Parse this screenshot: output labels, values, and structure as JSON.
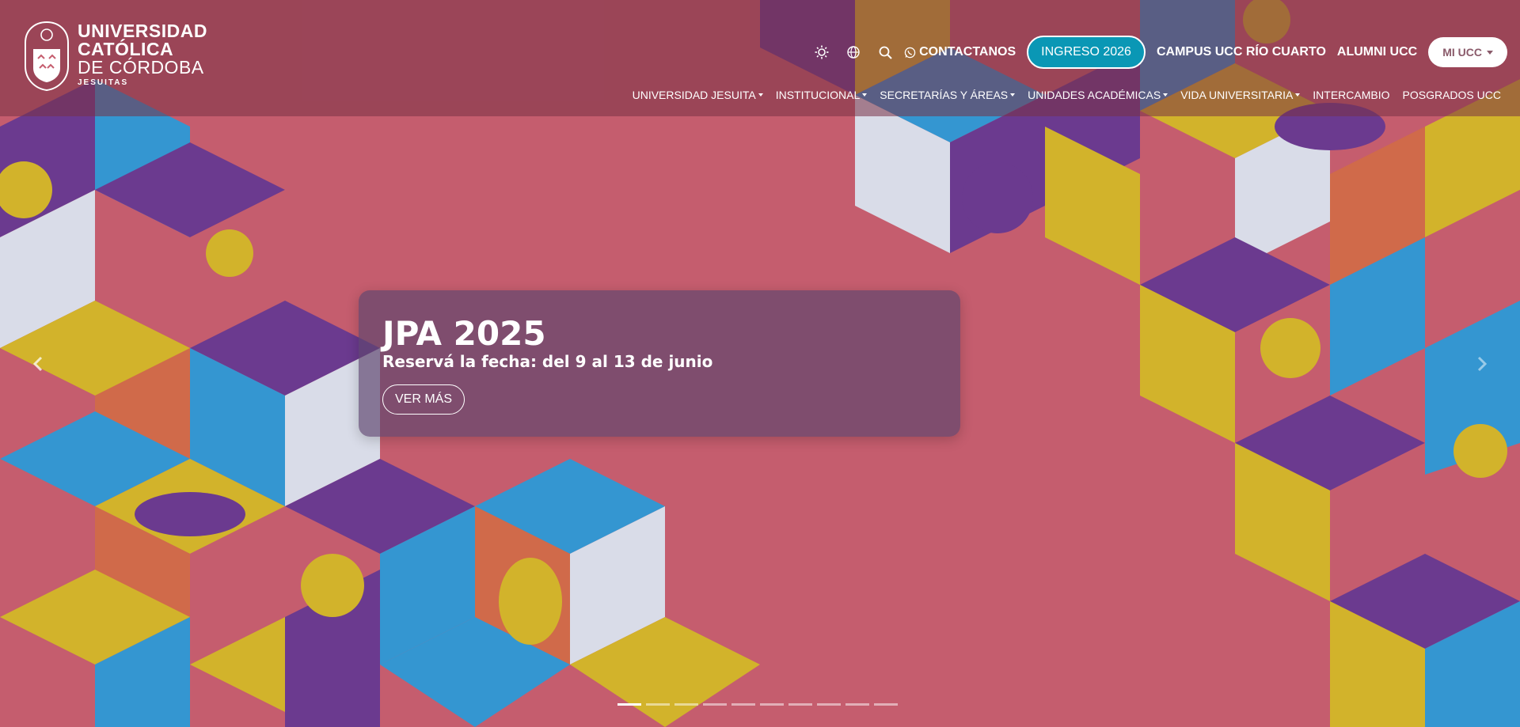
{
  "logo": {
    "line1": "UNIVERSIDAD",
    "line2": "CATÓLICA",
    "line3": "DE CÓRDOBA",
    "line4": "JESUITAS"
  },
  "topbar": {
    "contact_label": "CONTACTANOS",
    "ingreso_label": "INGRESO 2026",
    "campus_label": "CAMPUS UCC RÍO CUARTO",
    "alumni_label": "ALUMNI UCC",
    "miucc_label": "MI UCC"
  },
  "nav": {
    "items": [
      {
        "label": "UNIVERSIDAD JESUITA"
      },
      {
        "label": "INSTITUCIONAL"
      },
      {
        "label": "SECRETARÍAS Y ÁREAS"
      },
      {
        "label": "UNIDADES ACADÉMICAS"
      },
      {
        "label": "VIDA UNIVERSITARIA"
      },
      {
        "label": "INTERCAMBIO"
      },
      {
        "label": "POSGRADOS UCC"
      }
    ]
  },
  "slide": {
    "title": "JPA 2025",
    "subtitle": "Reservá la fecha: del 9 al 13 de junio",
    "cta": "VER MÁS"
  },
  "carousel": {
    "slide_count": 10,
    "active_index": 0
  },
  "colors": {
    "background": "#c55d6e",
    "purple": "#6b3a8f",
    "blue": "#3496d1",
    "yellow": "#d2b32b",
    "orange": "#d06a4a",
    "white": "#d9dce8",
    "accent": "#0a97b5"
  }
}
